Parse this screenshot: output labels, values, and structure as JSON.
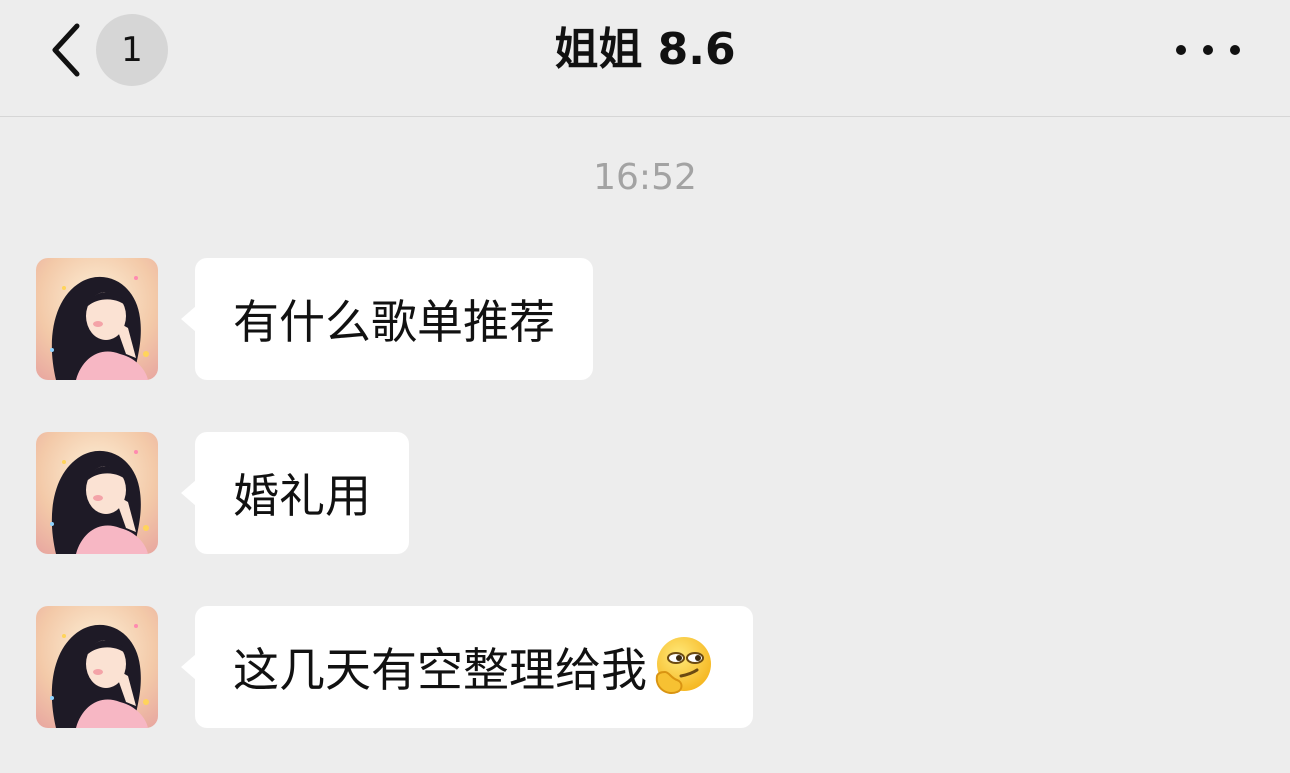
{
  "header": {
    "back_icon": "chevron-left-icon",
    "unread_count": "1",
    "title": "姐姐 8.6",
    "more_icon": "ellipsis-icon"
  },
  "timestamp": "16:52",
  "messages": [
    {
      "sender": "incoming",
      "text": "有什么歌单推荐"
    },
    {
      "sender": "incoming",
      "text": "婚礼用"
    },
    {
      "sender": "incoming",
      "text": "这几天有空整理给我",
      "emoji": "smirk-emoji"
    }
  ],
  "colors": {
    "background": "#ededed",
    "bubble": "#ffffff",
    "timestamp": "#a3a3a3",
    "badge": "#d6d6d6"
  }
}
